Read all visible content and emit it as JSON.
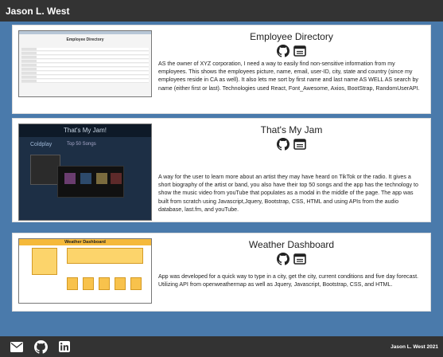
{
  "header": {
    "title": "Jason L. West"
  },
  "projects": [
    {
      "title": "Employee Directory",
      "thumb_title": "Employee Directory",
      "description": "AS the owner of XYZ corporation, I need a way to easily find non-sensitive information from my employees. This shows the employees picture, name, email, user-ID, city, state and country (since my employees reside in CA as well). It also lets me sort by first name and last name AS WELL AS search by name (either first or last). Technologies used React, Font_Awesome, Axios, BootStrap, RandomUserAPI."
    },
    {
      "title": "That's My Jam",
      "thumb_title": "That's My Jam!",
      "thumb_subtitle": "Top 50 Songs",
      "thumb_artist": "Coldplay",
      "description": "A way for the user to learn more about an artist they may have heard on TikTok or the radio. It gives a short biography of the artist or band, you also have their top 50 songs and the app has the technology to show the music video from youTube that populates as a modal in the middle of the page. The app was built from scratch using Javascript,Jquery, Bootstrap, CSS, HTML and using APIs from the audio database, last.fm, and youTube."
    },
    {
      "title": "Weather Dashboard",
      "thumb_title": "Weather Dashboard",
      "description": "App was developed for a quick way to type in a city, get the city, current conditions and five day forecast. Utilizing API from openweathermap as well as Jquery, Javascript, Bootstrap, CSS, and HTML."
    }
  ],
  "icons": {
    "repo": "github-icon",
    "live": "browser-window-icon"
  },
  "footer": {
    "icons": [
      "email-icon",
      "github-icon",
      "linkedin-icon"
    ],
    "credit": "Jason L. West 2021"
  },
  "colors": {
    "page_bg": "#4a7aab",
    "bar_bg": "#333333",
    "card_bg": "#ffffff"
  }
}
